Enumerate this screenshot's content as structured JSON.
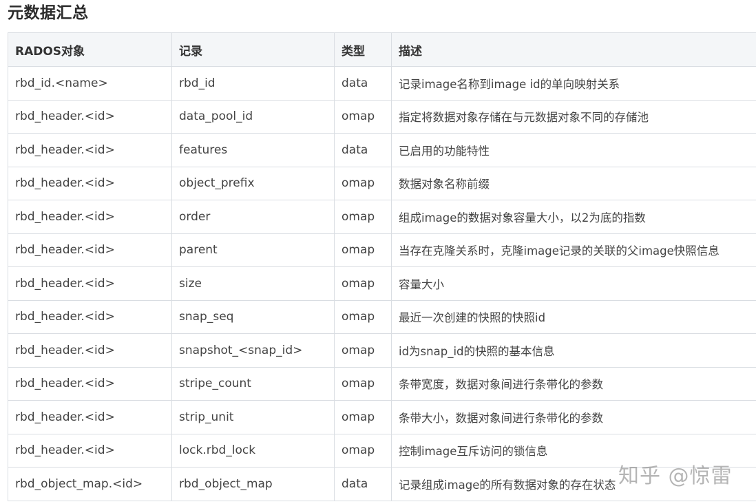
{
  "title": "元数据汇总",
  "table": {
    "headers": [
      "RADOS对象",
      "记录",
      "类型",
      "描述"
    ],
    "rows": [
      [
        "rbd_id.<name>",
        "rbd_id",
        "data",
        "记录image名称到image id的单向映射关系"
      ],
      [
        "rbd_header.<id>",
        "data_pool_id",
        "omap",
        "指定将数据对象存储在与元数据对象不同的存储池"
      ],
      [
        "rbd_header.<id>",
        "features",
        "data",
        "已启用的功能特性"
      ],
      [
        "rbd_header.<id>",
        "object_prefix",
        "omap",
        "数据对象名称前缀"
      ],
      [
        "rbd_header.<id>",
        "order",
        "omap",
        "组成image的数据对象容量大小，以2为底的指数"
      ],
      [
        "rbd_header.<id>",
        "parent",
        "omap",
        "当存在克隆关系时，克隆image记录的关联的父image快照信息"
      ],
      [
        "rbd_header.<id>",
        "size",
        "omap",
        "容量大小"
      ],
      [
        "rbd_header.<id>",
        "snap_seq",
        "omap",
        "最近一次创建的快照的快照id"
      ],
      [
        "rbd_header.<id>",
        "snapshot_<snap_id>",
        "omap",
        "id为snap_id的快照的基本信息"
      ],
      [
        "rbd_header.<id>",
        "stripe_count",
        "omap",
        "条带宽度，数据对象间进行条带化的参数"
      ],
      [
        "rbd_header.<id>",
        "strip_unit",
        "omap",
        "条带大小，数据对象间进行条带化的参数"
      ],
      [
        "rbd_header.<id>",
        "lock.rbd_lock",
        "omap",
        "控制image互斥访问的锁信息"
      ],
      [
        "rbd_object_map.<id>",
        "rbd_object_map",
        "data",
        "记录组成image的所有数据对象的存在状态"
      ]
    ]
  },
  "watermark": "知乎 @惊雷"
}
